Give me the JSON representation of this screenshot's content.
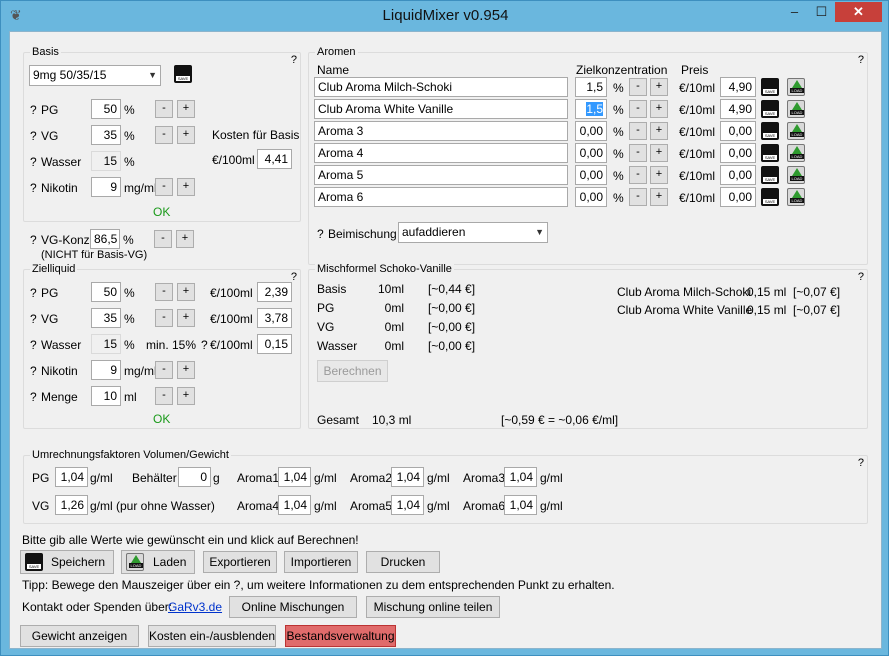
{
  "window": {
    "title": "LiquidMixer v0.954",
    "minimize": "–",
    "maximize": "☐",
    "close": "✕"
  },
  "basis": {
    "title": "Basis",
    "help": "?",
    "preset": "9mg 50/35/15",
    "pg_label": "PG",
    "pg_value": "50",
    "pg_unit": "%",
    "vg_label": "VG",
    "vg_value": "35",
    "vg_unit": "%",
    "wasser_label": "Wasser",
    "wasser_value": "15",
    "wasser_unit": "%",
    "nikotin_label": "Nikotin",
    "nikotin_value": "9",
    "nikotin_unit": "mg/ml",
    "kosten_label": "Kosten für Basis",
    "kosten_unit": "€/100ml",
    "kosten_value": "4,41",
    "status": "OK",
    "minus": "-",
    "plus": "+",
    "q": "?"
  },
  "vgkonz": {
    "label": "VG-Konz.",
    "value": "86,5",
    "unit": "%",
    "note": "(NICHT für Basis-VG)"
  },
  "ziel": {
    "title": "Zielliquid",
    "help": "?",
    "pg_value": "50",
    "vg_value": "35",
    "wasser_value": "15",
    "wasser_min": "min. 15%",
    "nikotin_value": "9",
    "menge_label": "Menge",
    "menge_value": "10",
    "menge_unit": "ml",
    "cost_unit": "€/100ml",
    "pg_cost": "2,39",
    "vg_cost": "3,78",
    "wasser_cost": "0,15",
    "status": "OK"
  },
  "aromen": {
    "title": "Aromen",
    "help": "?",
    "col_name": "Name",
    "col_konz": "Zielkonzentration",
    "col_preis": "Preis",
    "percent": "%",
    "price_unit": "€/10ml",
    "rows": [
      {
        "name": "Club Aroma Milch-Schoki",
        "konz": "1,5",
        "preis": "4,90"
      },
      {
        "name": "Club Aroma White Vanille",
        "konz": "1,5",
        "preis": "4,90"
      },
      {
        "name": "Aroma 3",
        "konz": "0,00",
        "preis": "0,00"
      },
      {
        "name": "Aroma 4",
        "konz": "0,00",
        "preis": "0,00"
      },
      {
        "name": "Aroma 5",
        "konz": "0,00",
        "preis": "0,00"
      },
      {
        "name": "Aroma 6",
        "konz": "0,00",
        "preis": "0,00"
      }
    ],
    "beimischung_label": "Beimischung",
    "beimischung_value": "aufaddieren"
  },
  "mischformel": {
    "title": "Mischformel Schoko-Vanille",
    "help": "?",
    "rows": [
      {
        "label": "Basis",
        "amount": "10ml",
        "cost": "[~0,44 €]"
      },
      {
        "label": "PG",
        "amount": "0ml",
        "cost": "[~0,00 €]"
      },
      {
        "label": "VG",
        "amount": "0ml",
        "cost": "[~0,00 €]"
      },
      {
        "label": "Wasser",
        "amount": "0ml",
        "cost": "[~0,00 €]"
      }
    ],
    "aromas": [
      {
        "label": "Club Aroma Milch-Schoki",
        "amount": "0,15 ml",
        "cost": "[~0,07 €]"
      },
      {
        "label": "Club Aroma White Vanille",
        "amount": "0,15 ml",
        "cost": "[~0,07 €]"
      }
    ],
    "berechnen": "Berechnen",
    "gesamt_label": "Gesamt",
    "gesamt_value": "10,3 ml",
    "gesamt_cost": "[~0,59 € = ~0,06 €/ml]"
  },
  "umrechnung": {
    "title": "Umrechnungsfaktoren Volumen/Gewicht",
    "help": "?",
    "pg_label": "PG",
    "pg_value": "1,04",
    "unit": "g/ml",
    "vg_label": "VG",
    "vg_value": "1,26",
    "vg_unit": "g/ml (pur ohne Wasser)",
    "behaelter_label": "Behälter",
    "behaelter_value": "0",
    "behaelter_unit": "g",
    "aroma1": "Aroma1",
    "aroma1_value": "1,04",
    "aroma2": "Aroma2",
    "aroma2_value": "1,04",
    "aroma3": "Aroma3",
    "aroma3_value": "1,04",
    "aroma4": "Aroma4",
    "aroma4_value": "1,04",
    "aroma5": "Aroma5",
    "aroma5_value": "1,04",
    "aroma6": "Aroma6",
    "aroma6_value": "1,04"
  },
  "footer": {
    "hint": "Bitte gib alle Werte wie gewünscht ein und klick auf Berechnen!",
    "speichern": "Speichern",
    "laden": "Laden",
    "exportieren": "Exportieren",
    "importieren": "Importieren",
    "drucken": "Drucken",
    "tipp": "Tipp: Bewege den Mauszeiger über ein ?, um weitere Informationen zu dem entsprechenden Punkt zu erhalten.",
    "kontakt": "Kontakt oder Spenden über:",
    "kontakt_link": "GaRv3.de",
    "online_mischungen": "Online Mischungen",
    "mischung_teilen": "Mischung online teilen",
    "gewicht": "Gewicht anzeigen",
    "kosten": "Kosten ein-/ausblenden",
    "bestand": "Bestandsverwaltung",
    "save_icon_text": "SAVE",
    "load_icon_text": "LOAD"
  }
}
